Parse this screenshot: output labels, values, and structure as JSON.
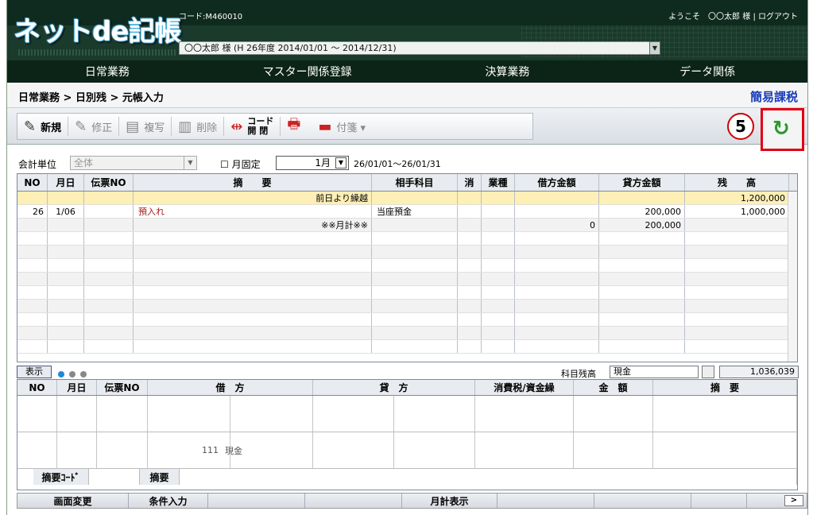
{
  "header": {
    "logo": "ネットde記帳",
    "code_label": "コード:M460010",
    "user_period": "〇〇太郎 様 (H 26年度 2014/01/01 ～ 2014/12/31)",
    "welcome": "ようこそ　〇〇太郎 様",
    "logout": "ログアウト"
  },
  "menu": [
    "日常業務",
    "マスター関係登録",
    "決算業務",
    "データ関係"
  ],
  "breadcrumb": "日常業務 > 日別残 > 元帳入力",
  "tax_mode": "簡易課税",
  "toolbar": {
    "new": "新規",
    "edit": "修正",
    "copy": "複写",
    "delete": "削除",
    "code_top": "コード",
    "code_bottom": "開 閉",
    "memo": "付箋 ▾",
    "step_number": "5"
  },
  "filter": {
    "unit_label": "会計単位",
    "unit_value": "全体",
    "month_fixed": "☐ 月固定",
    "month": "1月",
    "range": "26/01/01～26/01/31"
  },
  "main_table": {
    "headers": [
      "NO",
      "月日",
      "伝票NO",
      "摘　　要",
      "相手科目",
      "消",
      "業種",
      "借方金額",
      "貸方金額",
      "残　　高"
    ],
    "rows": [
      {
        "no": "",
        "date": "",
        "slip": "",
        "desc": "前日より繰越",
        "acct": "",
        "tax": "",
        "ind": "",
        "debit": "",
        "credit": "",
        "bal": "1,200,000"
      },
      {
        "no": "26",
        "date": "1/06",
        "slip": "",
        "desc": "預入れ",
        "acct": "当座預金",
        "tax": "",
        "ind": "",
        "debit": "",
        "credit": "200,000",
        "bal": "1,000,000"
      },
      {
        "no": "",
        "date": "",
        "slip": "",
        "desc": "※※月計※※",
        "acct": "",
        "tax": "",
        "ind": "",
        "debit": "0",
        "credit": "200,000",
        "bal": ""
      }
    ]
  },
  "status": {
    "show_button": "表示",
    "balance_label": "科目残高",
    "balance_account": "現金",
    "balance_value": "1,036,039"
  },
  "lower_table": {
    "headers": [
      "NO",
      "月日",
      "伝票NO",
      "借　方",
      "貸　方",
      "消費税/資金繰",
      "金　額",
      "摘　要"
    ],
    "account_code": "111",
    "account_name": "現金",
    "foot_code": "摘要ｺｰﾄﾞ",
    "foot_desc": "摘要"
  },
  "bottom": [
    "画面変更",
    "条件入力",
    "",
    "",
    "月計表示",
    "",
    "",
    ""
  ],
  "bottom_nav": ">"
}
